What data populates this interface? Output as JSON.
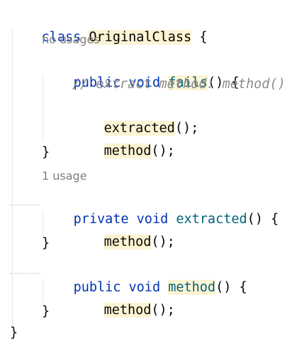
{
  "code": {
    "class_line": {
      "keyword": "class",
      "name": "OriginalClass",
      "brace": "{"
    },
    "fails_method": {
      "hint": "no usages",
      "modifier": "public",
      "return_type": "void",
      "name": "fails",
      "signature_tail": "() {",
      "comment": "// extract method: method()",
      "call_1_name": "extracted",
      "call_1_tail": "();",
      "call_2_name": "method",
      "call_2_tail": "();",
      "close": "}"
    },
    "extracted_method": {
      "hint": "1 usage",
      "modifier": "private",
      "return_type": "void",
      "name": "extracted",
      "signature_tail": "() {",
      "call_name": "method",
      "call_tail": "();",
      "close": "}"
    },
    "method_method": {
      "modifier": "public",
      "return_type": "void",
      "name": "method",
      "signature_tail": "() {",
      "call_name": "method",
      "call_tail": "();",
      "close": "}"
    },
    "class_close": "}"
  },
  "colors": {
    "keyword": "#0033b3",
    "method_declaration": "#00627a",
    "comment": "#8c8c8c",
    "hint": "#808080",
    "usage_highlight": "#fdf4d4",
    "text": "#080808"
  }
}
